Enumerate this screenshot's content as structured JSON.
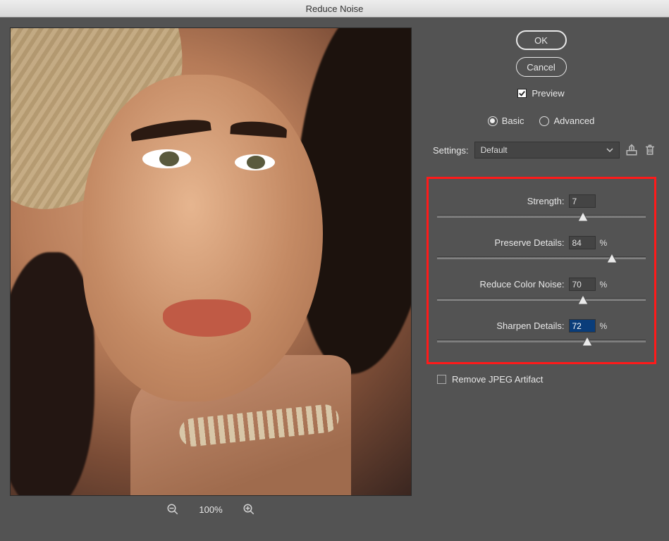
{
  "title": "Reduce Noise",
  "buttons": {
    "ok": "OK",
    "cancel": "Cancel"
  },
  "preview": {
    "label": "Preview",
    "checked": true
  },
  "mode": {
    "basic": "Basic",
    "advanced": "Advanced",
    "selected": "basic"
  },
  "settings": {
    "label": "Settings:",
    "value": "Default"
  },
  "zoom": {
    "level": "100%"
  },
  "sliders": {
    "strength": {
      "label": "Strength:",
      "value": "7",
      "unit": "",
      "max": 10,
      "pct": 70
    },
    "preserve_details": {
      "label": "Preserve Details:",
      "value": "84",
      "unit": "%",
      "max": 100,
      "pct": 84
    },
    "reduce_color": {
      "label": "Reduce Color Noise:",
      "value": "70",
      "unit": "%",
      "max": 100,
      "pct": 70
    },
    "sharpen_details": {
      "label": "Sharpen Details:",
      "value": "72",
      "unit": "%",
      "max": 100,
      "pct": 72,
      "selected": true
    }
  },
  "remove_jpeg": {
    "label": "Remove JPEG Artifact",
    "checked": false
  }
}
